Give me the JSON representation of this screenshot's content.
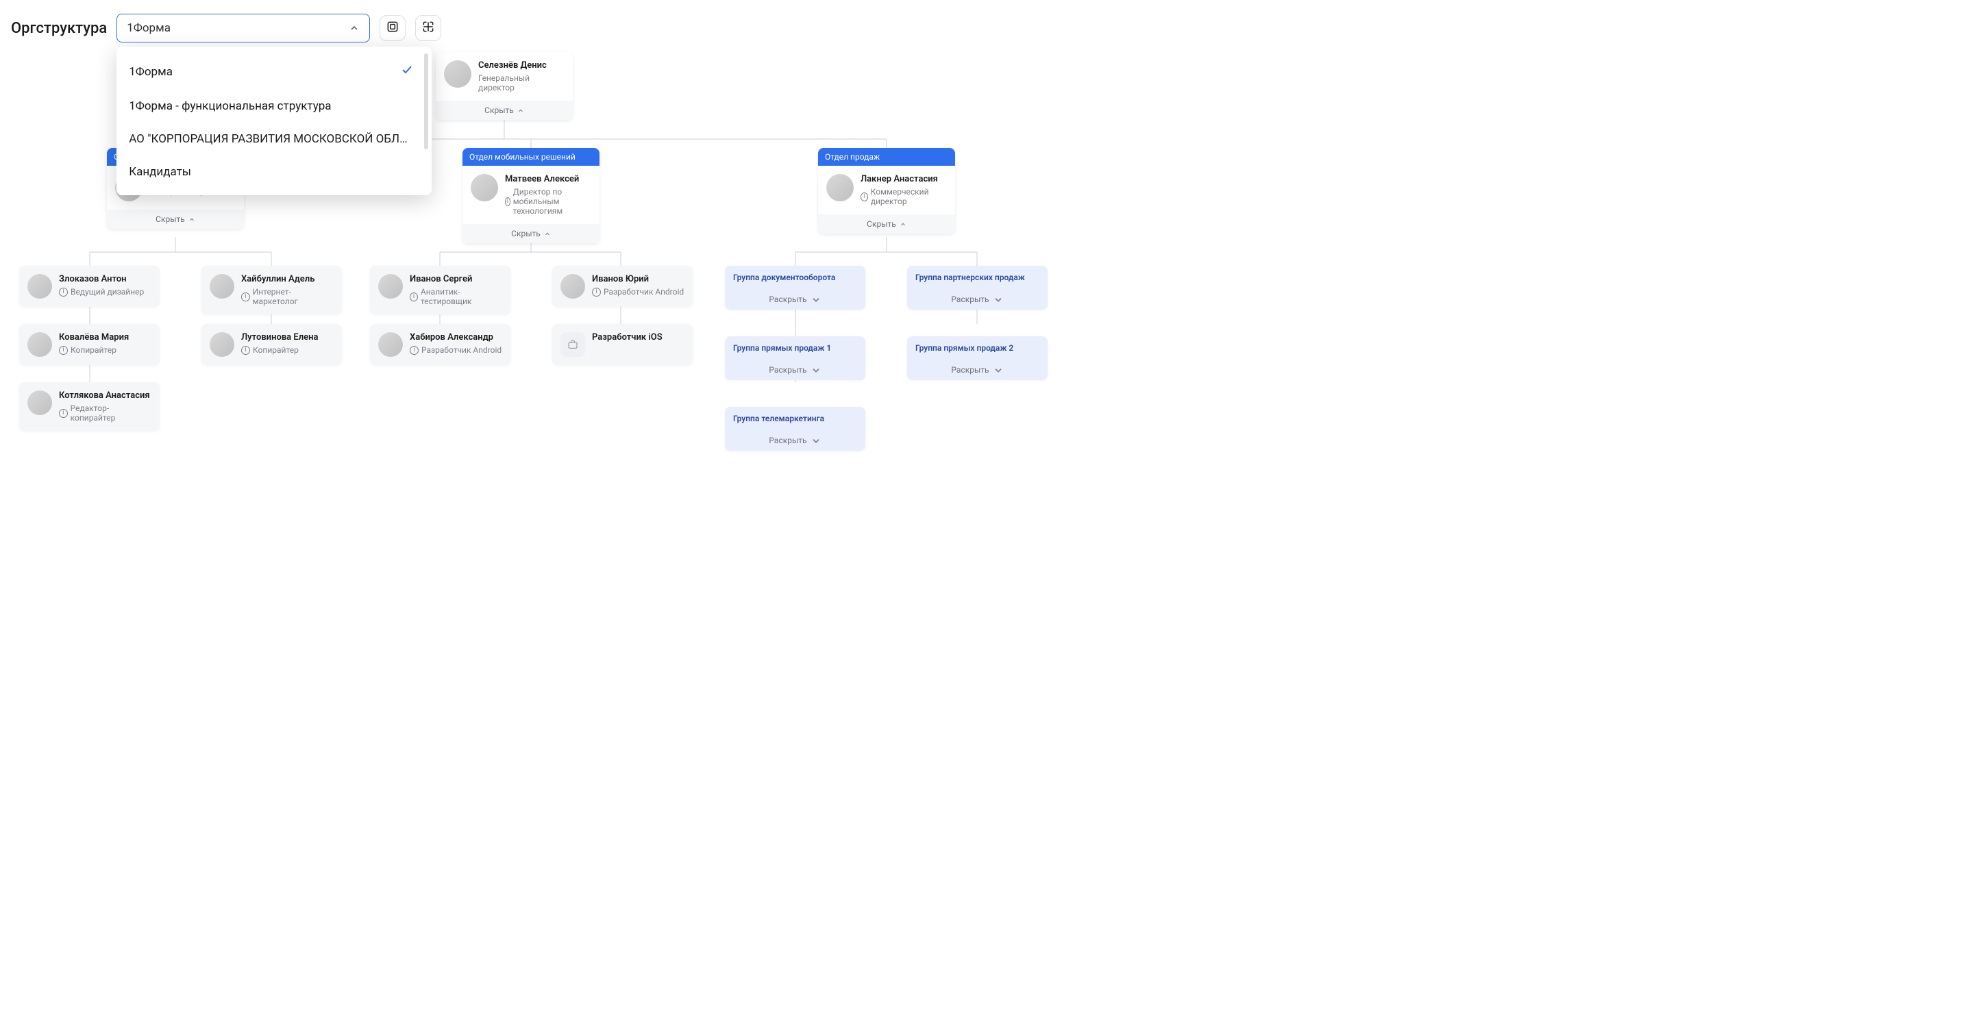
{
  "page_title": "Оргструктура",
  "select": {
    "value": "1Форма",
    "options": [
      "1Форма",
      "1Форма - функциональная структура",
      "АО \"КОРПОРАЦИЯ РАЗВИТИЯ МОСКОВСКОЙ ОБЛАС...",
      "Кандидаты"
    ],
    "selected_index": 0
  },
  "toggle_labels": {
    "hide": "Скрыть",
    "expand": "Раскрыть"
  },
  "root": {
    "name": "Селезнёв Денис",
    "role": "Генеральный директор"
  },
  "departments": [
    {
      "title": "Отд",
      "head": {
        "name": "",
        "role": "Директор по маркетингу"
      },
      "employees": [
        {
          "name": "Злоказов Антон",
          "role": "Ведущий дизайнер"
        },
        {
          "name": "Ковалёва Мария",
          "role": "Копирайтер"
        },
        {
          "name": "Котлякова Анастасия",
          "role": "Редактор-копирайтер"
        },
        {
          "name": "Хайбуллин Адель",
          "role": "Интернет-маркетолог"
        },
        {
          "name": "Лутовинова Елена",
          "role": "Копирайтер"
        }
      ]
    },
    {
      "title": "Отдел мобильных решений",
      "head": {
        "name": "Матвеев Алексей",
        "role": "Директор по мобильным технологиям"
      },
      "employees": [
        {
          "name": "Иванов Сергей",
          "role": "Аналитик-тестировщик"
        },
        {
          "name": "Хабиров Александр",
          "role": "Разработчик Android"
        },
        {
          "name": "Иванов Юрий",
          "role": "Разработчик Android"
        },
        {
          "name": "Разработчик iOS",
          "role": "",
          "vacant": true
        }
      ]
    },
    {
      "title": "Отдел продаж",
      "head": {
        "name": "Лакнер Анастасия",
        "role": "Коммерческий директор"
      },
      "groups": [
        "Группа документооборота",
        "Группа прямых продаж 1",
        "Группа телемаркетинга",
        "Группа партнерских продаж",
        "Группа прямых продаж 2"
      ]
    }
  ]
}
